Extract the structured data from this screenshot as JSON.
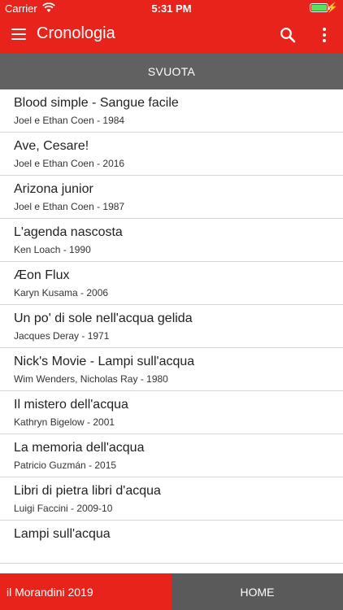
{
  "status_bar": {
    "carrier": "Carrier",
    "time": "5:31 PM",
    "battery_level": 1.0
  },
  "app_bar": {
    "title": "Cronologia",
    "menu_icon": "hamburger-menu-icon",
    "search_icon": "search-icon",
    "more_icon": "more-vert-icon"
  },
  "clear_button": {
    "label": "SVUOTA"
  },
  "history": [
    {
      "title": "Blood simple - Sangue facile",
      "subtitle": "Joel e Ethan Coen - 1984"
    },
    {
      "title": "Ave, Cesare!",
      "subtitle": "Joel e Ethan Coen - 2016"
    },
    {
      "title": "Arizona junior",
      "subtitle": "Joel e Ethan Coen - 1987"
    },
    {
      "title": "L'agenda nascosta",
      "subtitle": "Ken Loach - 1990"
    },
    {
      "title": "Æon Flux",
      "subtitle": "Karyn Kusama - 2006"
    },
    {
      "title": "Un po' di sole nell'acqua gelida",
      "subtitle": "Jacques Deray - 1971"
    },
    {
      "title": "Nick's Movie - Lampi sull'acqua",
      "subtitle": "Wim Wenders, Nicholas Ray - 1980"
    },
    {
      "title": "Il mistero dell'acqua",
      "subtitle": "Kathryn Bigelow - 2001"
    },
    {
      "title": "La memoria dell'acqua",
      "subtitle": "Patricio Guzmán - 2015"
    },
    {
      "title": "Libri di pietra libri d'acqua",
      "subtitle": "Luigi Faccini - 2009-10"
    },
    {
      "title": "Lampi sull'acqua",
      "subtitle": ""
    }
  ],
  "bottom_bar": {
    "left_label": "il Morandini 2019",
    "right_label": "HOME"
  },
  "colors": {
    "accent": "#e8231b",
    "clear_bar": "#616161",
    "home_bar": "#5a5a5a"
  }
}
